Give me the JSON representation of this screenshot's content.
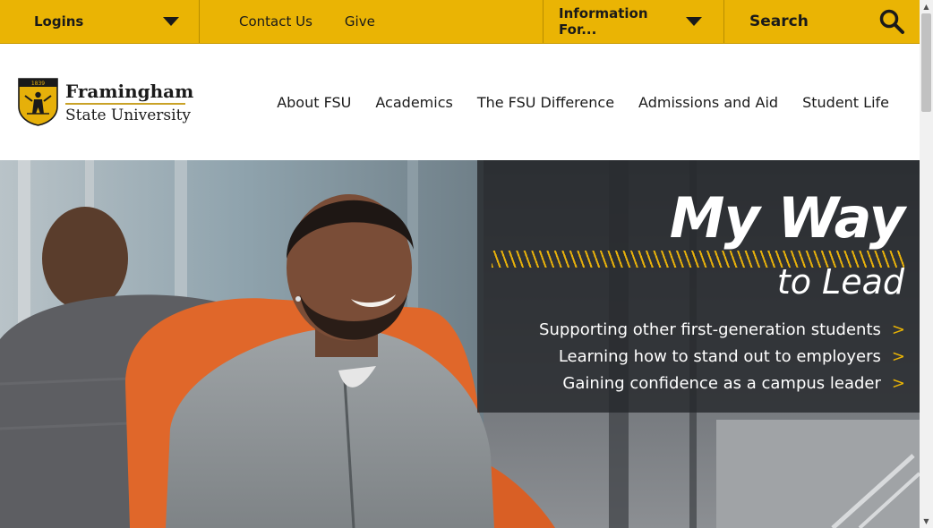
{
  "topbar": {
    "logins_label": "Logins",
    "links": [
      "Contact Us",
      "Give"
    ],
    "info_label": "Information For...",
    "search_label": "Search"
  },
  "logo": {
    "seal_year": "1839",
    "line1": "Framingham",
    "line2": "State University"
  },
  "nav": {
    "items": [
      "About FSU",
      "Academics",
      "The FSU Difference",
      "Admissions and Aid",
      "Student Life"
    ]
  },
  "hero": {
    "headline_line1": "My Way",
    "headline_line2": "to Lead",
    "stories": [
      "Supporting other first-generation students",
      "Learning how to stand out to employers",
      "Gaining confidence as a campus leader"
    ],
    "arrow": ">"
  },
  "colors": {
    "brand_gold": "#eab404",
    "panel_dark": "#26282c",
    "text_dark": "#1a1a1a"
  },
  "scrollbar": {
    "up_arrow": "▲",
    "down_arrow": "▼"
  }
}
